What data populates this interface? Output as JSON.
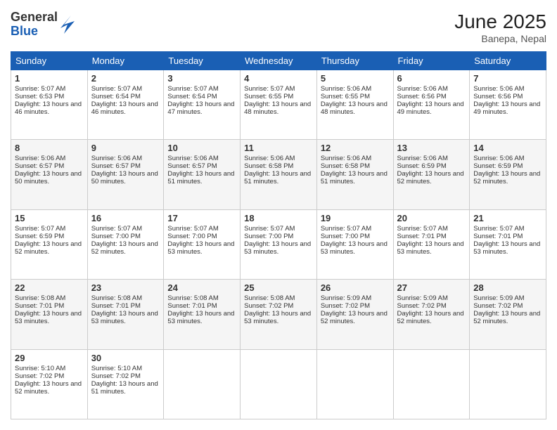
{
  "header": {
    "logo_general": "General",
    "logo_blue": "Blue",
    "month": "June 2025",
    "location": "Banepa, Nepal"
  },
  "weekdays": [
    "Sunday",
    "Monday",
    "Tuesday",
    "Wednesday",
    "Thursday",
    "Friday",
    "Saturday"
  ],
  "weeks": [
    [
      {
        "day": "1",
        "sunrise": "5:07 AM",
        "sunset": "6:53 PM",
        "daylight": "13 hours and 46 minutes."
      },
      {
        "day": "2",
        "sunrise": "5:07 AM",
        "sunset": "6:54 PM",
        "daylight": "13 hours and 46 minutes."
      },
      {
        "day": "3",
        "sunrise": "5:07 AM",
        "sunset": "6:54 PM",
        "daylight": "13 hours and 47 minutes."
      },
      {
        "day": "4",
        "sunrise": "5:07 AM",
        "sunset": "6:55 PM",
        "daylight": "13 hours and 48 minutes."
      },
      {
        "day": "5",
        "sunrise": "5:06 AM",
        "sunset": "6:55 PM",
        "daylight": "13 hours and 48 minutes."
      },
      {
        "day": "6",
        "sunrise": "5:06 AM",
        "sunset": "6:56 PM",
        "daylight": "13 hours and 49 minutes."
      },
      {
        "day": "7",
        "sunrise": "5:06 AM",
        "sunset": "6:56 PM",
        "daylight": "13 hours and 49 minutes."
      }
    ],
    [
      {
        "day": "8",
        "sunrise": "5:06 AM",
        "sunset": "6:57 PM",
        "daylight": "13 hours and 50 minutes."
      },
      {
        "day": "9",
        "sunrise": "5:06 AM",
        "sunset": "6:57 PM",
        "daylight": "13 hours and 50 minutes."
      },
      {
        "day": "10",
        "sunrise": "5:06 AM",
        "sunset": "6:57 PM",
        "daylight": "13 hours and 51 minutes."
      },
      {
        "day": "11",
        "sunrise": "5:06 AM",
        "sunset": "6:58 PM",
        "daylight": "13 hours and 51 minutes."
      },
      {
        "day": "12",
        "sunrise": "5:06 AM",
        "sunset": "6:58 PM",
        "daylight": "13 hours and 51 minutes."
      },
      {
        "day": "13",
        "sunrise": "5:06 AM",
        "sunset": "6:59 PM",
        "daylight": "13 hours and 52 minutes."
      },
      {
        "day": "14",
        "sunrise": "5:06 AM",
        "sunset": "6:59 PM",
        "daylight": "13 hours and 52 minutes."
      }
    ],
    [
      {
        "day": "15",
        "sunrise": "5:07 AM",
        "sunset": "6:59 PM",
        "daylight": "13 hours and 52 minutes."
      },
      {
        "day": "16",
        "sunrise": "5:07 AM",
        "sunset": "7:00 PM",
        "daylight": "13 hours and 52 minutes."
      },
      {
        "day": "17",
        "sunrise": "5:07 AM",
        "sunset": "7:00 PM",
        "daylight": "13 hours and 53 minutes."
      },
      {
        "day": "18",
        "sunrise": "5:07 AM",
        "sunset": "7:00 PM",
        "daylight": "13 hours and 53 minutes."
      },
      {
        "day": "19",
        "sunrise": "5:07 AM",
        "sunset": "7:00 PM",
        "daylight": "13 hours and 53 minutes."
      },
      {
        "day": "20",
        "sunrise": "5:07 AM",
        "sunset": "7:01 PM",
        "daylight": "13 hours and 53 minutes."
      },
      {
        "day": "21",
        "sunrise": "5:07 AM",
        "sunset": "7:01 PM",
        "daylight": "13 hours and 53 minutes."
      }
    ],
    [
      {
        "day": "22",
        "sunrise": "5:08 AM",
        "sunset": "7:01 PM",
        "daylight": "13 hours and 53 minutes."
      },
      {
        "day": "23",
        "sunrise": "5:08 AM",
        "sunset": "7:01 PM",
        "daylight": "13 hours and 53 minutes."
      },
      {
        "day": "24",
        "sunrise": "5:08 AM",
        "sunset": "7:01 PM",
        "daylight": "13 hours and 53 minutes."
      },
      {
        "day": "25",
        "sunrise": "5:08 AM",
        "sunset": "7:02 PM",
        "daylight": "13 hours and 53 minutes."
      },
      {
        "day": "26",
        "sunrise": "5:09 AM",
        "sunset": "7:02 PM",
        "daylight": "13 hours and 52 minutes."
      },
      {
        "day": "27",
        "sunrise": "5:09 AM",
        "sunset": "7:02 PM",
        "daylight": "13 hours and 52 minutes."
      },
      {
        "day": "28",
        "sunrise": "5:09 AM",
        "sunset": "7:02 PM",
        "daylight": "13 hours and 52 minutes."
      }
    ],
    [
      {
        "day": "29",
        "sunrise": "5:10 AM",
        "sunset": "7:02 PM",
        "daylight": "13 hours and 52 minutes."
      },
      {
        "day": "30",
        "sunrise": "5:10 AM",
        "sunset": "7:02 PM",
        "daylight": "13 hours and 51 minutes."
      },
      null,
      null,
      null,
      null,
      null
    ]
  ]
}
